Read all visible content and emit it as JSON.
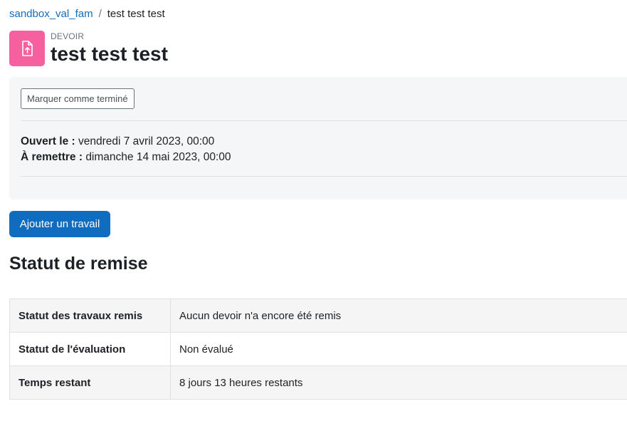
{
  "breadcrumb": {
    "course_link": "sandbox_val_fam",
    "separator": "/",
    "current": "test test test"
  },
  "header": {
    "icon": "assignment-upload-icon",
    "icon_color": "#f7609e",
    "activity_type": "DEVOIR",
    "title": "test test test"
  },
  "info": {
    "completion_button": "Marquer comme terminé",
    "opened_label": "Ouvert le :",
    "opened_value": "vendredi 7 avril 2023, 00:00",
    "due_label": "À remettre :",
    "due_value": "dimanche 14 mai 2023, 00:00"
  },
  "actions": {
    "add_submission": "Ajouter un travail"
  },
  "submission_status": {
    "heading": "Statut de remise",
    "rows": [
      {
        "label": "Statut des travaux remis",
        "value": "Aucun devoir n'a encore été remis"
      },
      {
        "label": "Statut de l'évaluation",
        "value": "Non évalué"
      },
      {
        "label": "Temps restant",
        "value": "8 jours 13 heures restants"
      }
    ]
  },
  "colors": {
    "primary": "#0f6cbf",
    "icon_bg": "#f7609e"
  }
}
